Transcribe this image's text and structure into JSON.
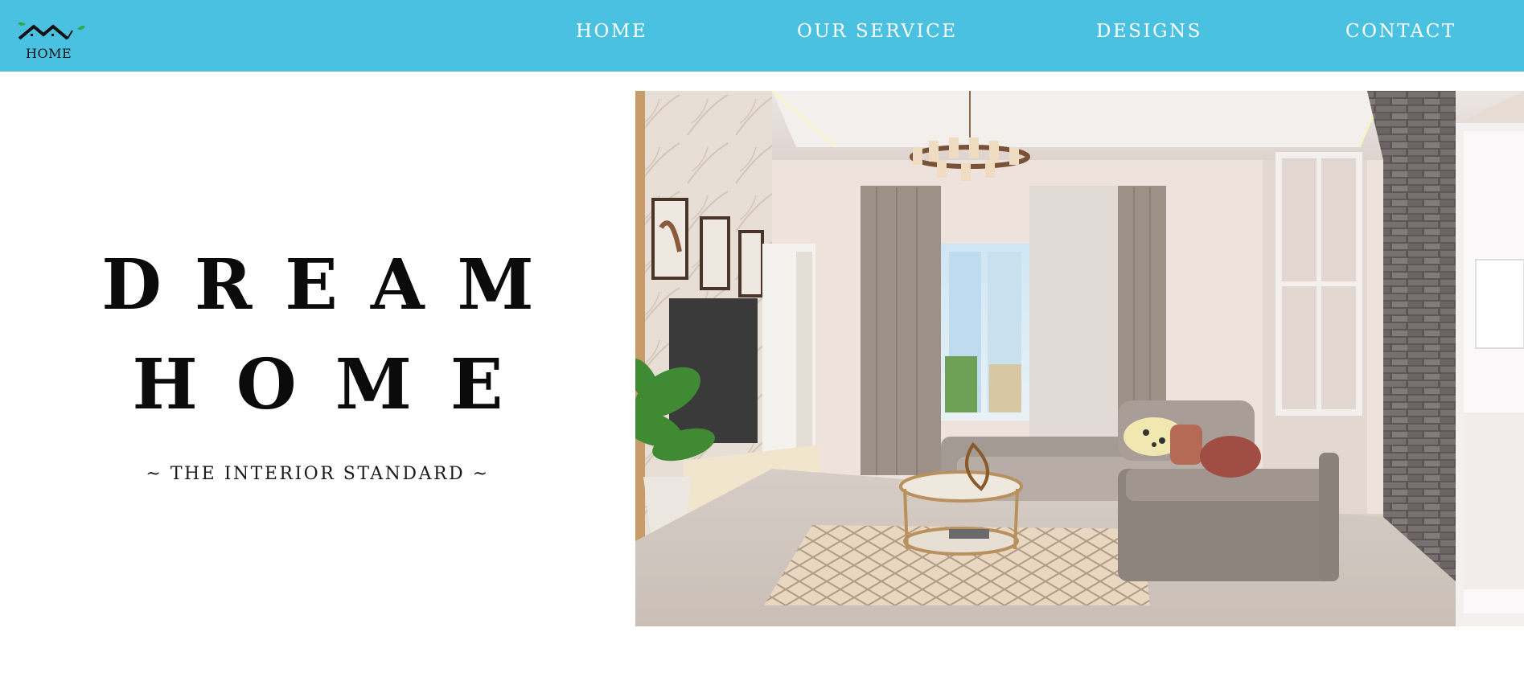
{
  "header": {
    "logo": {
      "text": "HOME",
      "icon": "house-roof-leaves-icon"
    },
    "nav": [
      {
        "label": "HOME"
      },
      {
        "label": "OUR SERVICE"
      },
      {
        "label": "DESIGNS"
      },
      {
        "label": "CONTACT"
      }
    ]
  },
  "hero": {
    "title_line1": "DREAM",
    "title_line2": "HOME",
    "tagline": "~ THE INTERIOR STANDARD ~",
    "image": {
      "subject": "living-room-interior-photo"
    }
  },
  "colors": {
    "navbar_background": "#4ac1e0",
    "nav_text": "#ffffff",
    "heading_text": "#0b0b0b",
    "page_background": "#ffffff"
  }
}
